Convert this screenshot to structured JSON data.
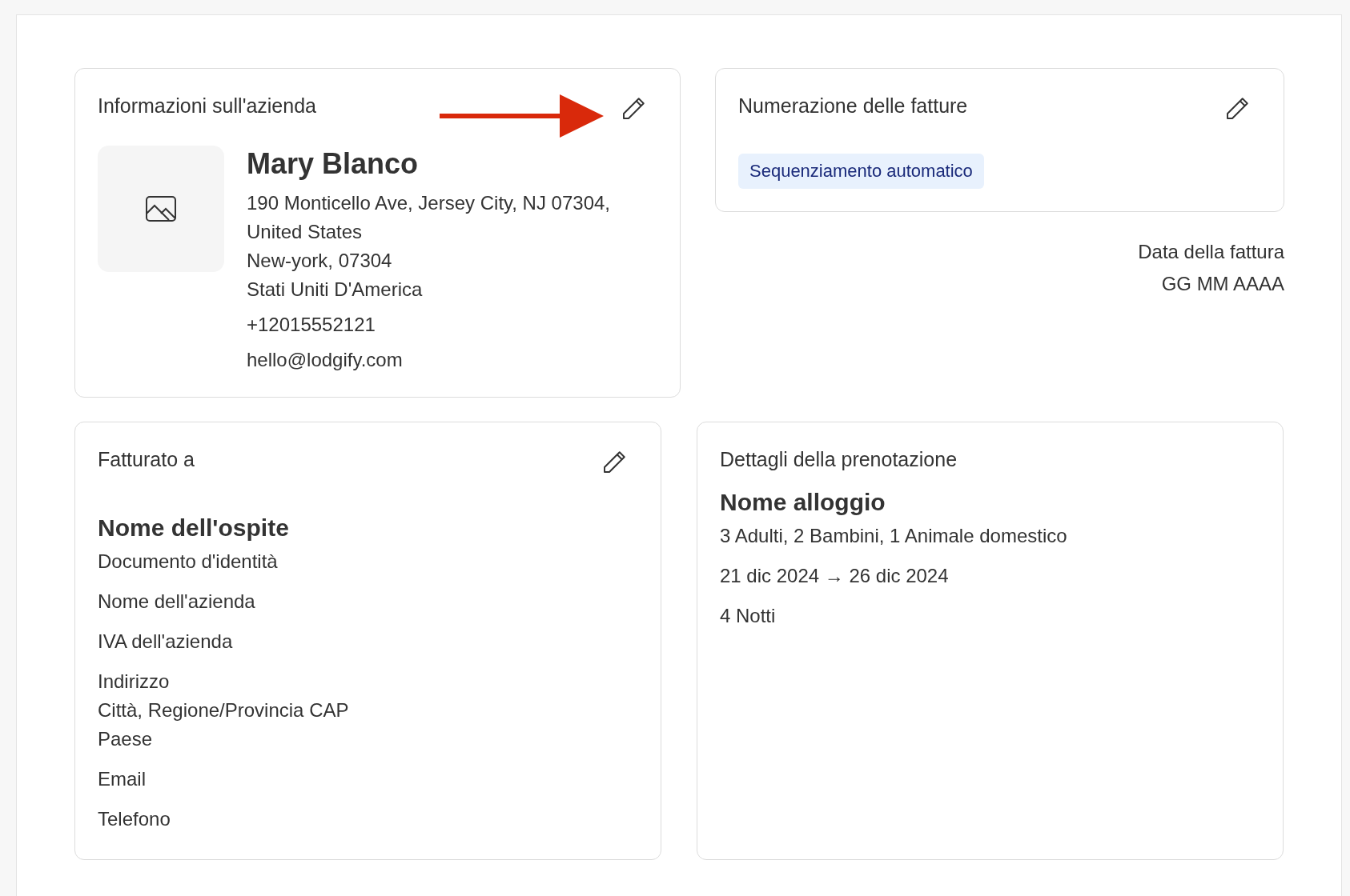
{
  "company": {
    "title": "Informazioni sull'azienda",
    "name": "Mary Blanco",
    "address_lines": [
      "190 Monticello Ave, Jersey City, NJ 07304,",
      "United States",
      "New-york, 07304",
      "Stati Uniti D'America"
    ],
    "phone": "+12015552121",
    "email": "hello@lodgify.com"
  },
  "invoice_numbering": {
    "title": "Numerazione delle fatture",
    "badge": "Sequenziamento automatico"
  },
  "invoice_date": {
    "label": "Data della fattura",
    "value": "GG MM AAAA"
  },
  "billed_to": {
    "title": "Fatturato a",
    "guest_name": "Nome dell'ospite",
    "fields": [
      {
        "kind": "line",
        "text": "Documento d'identità"
      },
      {
        "kind": "line",
        "text": "Nome dell'azienda"
      },
      {
        "kind": "line",
        "text": "IVA dell'azienda"
      },
      {
        "kind": "block",
        "lines": [
          "Indirizzo",
          "Città, Regione/Provincia CAP",
          "Paese"
        ]
      },
      {
        "kind": "line",
        "text": "Email"
      },
      {
        "kind": "line",
        "text": "Telefono"
      }
    ]
  },
  "booking": {
    "title": "Dettagli della prenotazione",
    "property_name": "Nome alloggio",
    "guests": "3 Adulti, 2 Bambini, 1 Animale domestico",
    "dates": "21 dic 2024 → 26 dic 2024",
    "nights": "4 Notti"
  }
}
